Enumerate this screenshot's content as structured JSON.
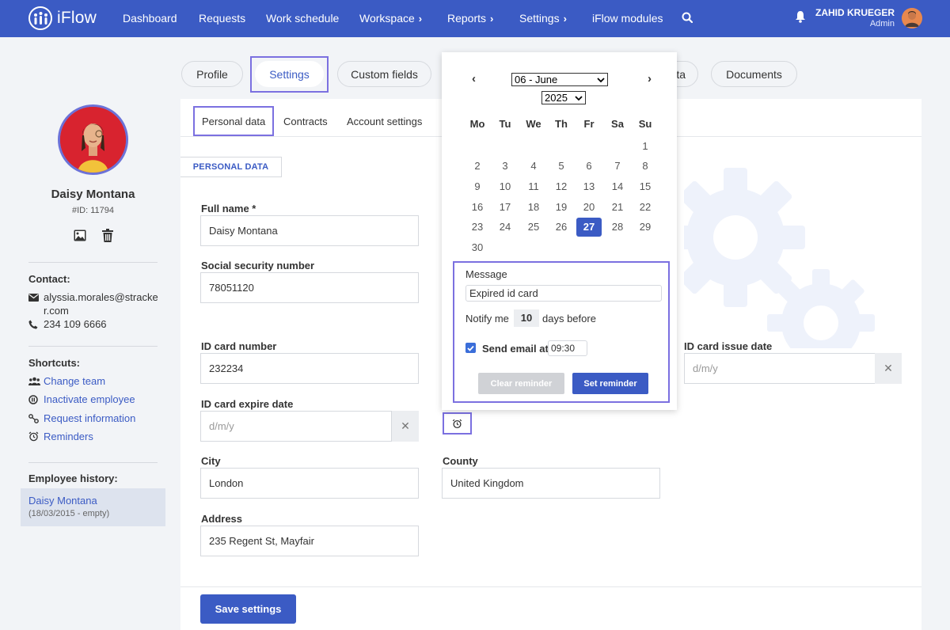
{
  "app": {
    "logo_text": "iFlow"
  },
  "nav": {
    "items": [
      {
        "label": "Dashboard"
      },
      {
        "label": "Requests"
      },
      {
        "label": "Work schedule"
      },
      {
        "label": "Workspace",
        "chevron": "›"
      },
      {
        "label": "Reports",
        "chevron": "›"
      },
      {
        "label": "Settings",
        "chevron": "›"
      },
      {
        "label": "iFlow modules"
      }
    ],
    "user_name": "ZAHID KRUEGER",
    "user_role": "Admin"
  },
  "profile": {
    "name": "Daisy Montana",
    "id": "#ID: 11794"
  },
  "sidebar": {
    "contact_heading": "Contact:",
    "email": "alyssia.morales@stracker.com",
    "phone": "234 109 6666",
    "shortcuts_heading": "Shortcuts:",
    "shortcuts": [
      {
        "label": "Change team",
        "icon": "team-icon"
      },
      {
        "label": "Inactivate employee",
        "icon": "inactivate-icon"
      },
      {
        "label": "Request information",
        "icon": "link-icon"
      },
      {
        "label": "Reminders",
        "icon": "alarm-icon"
      }
    ],
    "history_heading": "Employee history:",
    "history_name": "Daisy Montana",
    "history_meta": "(18/03/2015 - empty)"
  },
  "tabs": [
    {
      "label": "Profile"
    },
    {
      "label": "Settings"
    },
    {
      "label": "Custom fields"
    },
    {
      "label": "ta"
    },
    {
      "label": "Documents"
    }
  ],
  "subtabs": [
    {
      "label": "Personal data"
    },
    {
      "label": "Contracts"
    },
    {
      "label": "Account settings"
    }
  ],
  "section_tag": "PERSONAL DATA",
  "form": {
    "full_name_label": "Full name *",
    "full_name": "Daisy Montana",
    "ssn_label": "Social security number",
    "ssn": "78051120",
    "id_number_label": "ID card number",
    "id_number": "232234",
    "id_issue_label": "ID card issue date",
    "id_issue_placeholder": "d/m/y",
    "id_expire_label": "ID card expire date",
    "id_expire_placeholder": "d/m/y",
    "city_label": "City",
    "city": "London",
    "county_label": "County",
    "county": "United Kingdom",
    "address_label": "Address",
    "address": "235 Regent St, Mayfair",
    "clear_symbol": "✕"
  },
  "save_button": "Save settings",
  "calendar": {
    "prev": "‹",
    "next": "›",
    "month": "06 - June",
    "year": "2025",
    "weekdays": [
      "Mo",
      "Tu",
      "We",
      "Th",
      "Fr",
      "Sa",
      "Su"
    ],
    "selected_day": 27,
    "days": [
      [
        null,
        null,
        null,
        null,
        null,
        null,
        1
      ],
      [
        2,
        3,
        4,
        5,
        6,
        7,
        8
      ],
      [
        9,
        10,
        11,
        12,
        13,
        14,
        15
      ],
      [
        16,
        17,
        18,
        19,
        20,
        21,
        22
      ],
      [
        23,
        24,
        25,
        26,
        27,
        28,
        29
      ],
      [
        30,
        null,
        null,
        null,
        null,
        null,
        null
      ]
    ]
  },
  "reminder": {
    "message_label": "Message",
    "message": "Expired id card",
    "notify_label": "Notify me",
    "days_value": "10",
    "days_after": "days before",
    "send_email_label": "Send email at",
    "time": "09:30",
    "clear_button": "Clear reminder",
    "set_button": "Set reminder"
  },
  "colors": {
    "brand": "#3b5bc4",
    "highlight": "#7b70e0"
  }
}
